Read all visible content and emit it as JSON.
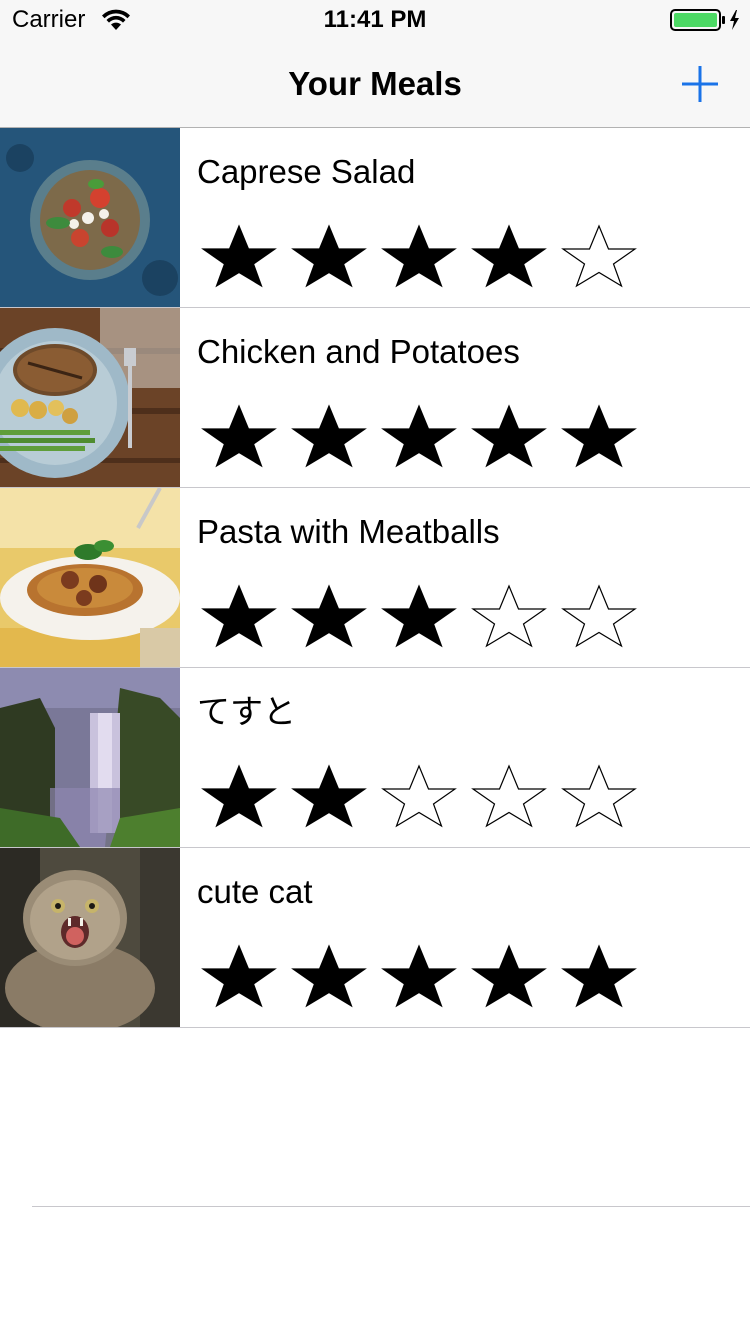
{
  "status_bar": {
    "carrier": "Carrier",
    "time": "11:41 PM",
    "battery_color": "#4cd964",
    "icons": [
      "wifi-icon",
      "battery-icon",
      "charging-bolt-icon"
    ]
  },
  "nav": {
    "title": "Your Meals",
    "add_icon": "plus-icon",
    "accent_color": "#1a73e8"
  },
  "meals": [
    {
      "name": "Caprese Salad",
      "rating": 4,
      "photo": "caprese-salad-photo"
    },
    {
      "name": "Chicken and Potatoes",
      "rating": 5,
      "photo": "chicken-and-potatoes-photo"
    },
    {
      "name": "Pasta with Meatballs",
      "rating": 3,
      "photo": "pasta-with-meatballs-photo"
    },
    {
      "name": "てすと",
      "rating": 2,
      "photo": "waterfall-photo"
    },
    {
      "name": "cute cat",
      "rating": 5,
      "photo": "cat-photo"
    }
  ],
  "rating_max": 5
}
